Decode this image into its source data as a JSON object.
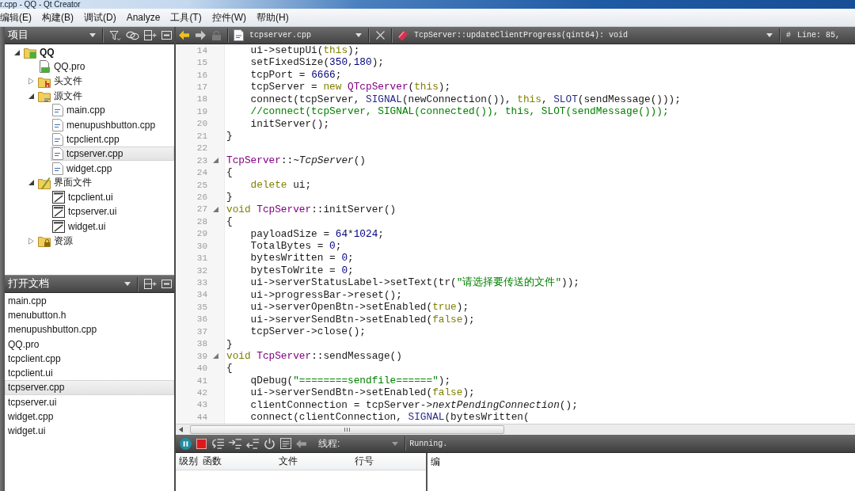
{
  "window": {
    "title": "r.cpp - QQ - Qt Creator"
  },
  "menu_bar": [
    "编辑(E)",
    "构建(B)",
    "调试(D)",
    "Analyze",
    "工具(T)",
    "控件(W)",
    "帮助(H)"
  ],
  "project_panel": {
    "title": "项目",
    "tree": [
      {
        "label": "QQ",
        "kind": "project",
        "expanded": true,
        "selected": false,
        "children": [
          {
            "label": "QQ.pro",
            "kind": "pro-file",
            "selected": false
          },
          {
            "label": "头文件",
            "kind": "headers",
            "expanded": false,
            "selected": false
          },
          {
            "label": "源文件",
            "kind": "sources",
            "expanded": true,
            "selected": false,
            "children": [
              {
                "label": "main.cpp",
                "kind": "cpp-file",
                "selected": false
              },
              {
                "label": "menupushbutton.cpp",
                "kind": "cpp-file",
                "selected": false
              },
              {
                "label": "tcpclient.cpp",
                "kind": "cpp-file",
                "selected": false
              },
              {
                "label": "tcpserver.cpp",
                "kind": "cpp-file",
                "selected": true
              },
              {
                "label": "widget.cpp",
                "kind": "cpp-file",
                "selected": false
              }
            ]
          },
          {
            "label": "界面文件",
            "kind": "forms",
            "expanded": true,
            "selected": false,
            "children": [
              {
                "label": "tcpclient.ui",
                "kind": "ui-file",
                "selected": false
              },
              {
                "label": "tcpserver.ui",
                "kind": "ui-file",
                "selected": false
              },
              {
                "label": "widget.ui",
                "kind": "ui-file",
                "selected": false
              }
            ]
          },
          {
            "label": "资源",
            "kind": "resources",
            "expanded": false,
            "selected": false
          }
        ]
      }
    ]
  },
  "open_documents": {
    "title": "打开文档",
    "items": [
      {
        "label": "main.cpp",
        "selected": false
      },
      {
        "label": "menubutton.h",
        "selected": false
      },
      {
        "label": "menupushbutton.cpp",
        "selected": false
      },
      {
        "label": "QQ.pro",
        "selected": false
      },
      {
        "label": "tcpclient.cpp",
        "selected": false
      },
      {
        "label": "tcpclient.ui",
        "selected": false
      },
      {
        "label": "tcpserver.cpp",
        "selected": true
      },
      {
        "label": "tcpserver.ui",
        "selected": false
      },
      {
        "label": "widget.cpp",
        "selected": false
      },
      {
        "label": "widget.ui",
        "selected": false
      }
    ]
  },
  "editor": {
    "document": "tcpserver.cpp",
    "symbol": "TcpServer::updateClientProgress(qint64): void",
    "line_marker": "#",
    "position": "Line: 85,",
    "lines": [
      {
        "number": "14",
        "foldable": false,
        "tokens": [
          {
            "kind": "plain",
            "text": "    ui->setupUi("
          },
          {
            "kind": "keyword",
            "text": "this"
          },
          {
            "kind": "plain",
            "text": ");"
          }
        ]
      },
      {
        "number": "15",
        "foldable": false,
        "tokens": [
          {
            "kind": "plain",
            "text": "    setFixedSize("
          },
          {
            "kind": "number",
            "text": "350"
          },
          {
            "kind": "plain",
            "text": ","
          },
          {
            "kind": "number",
            "text": "180"
          },
          {
            "kind": "plain",
            "text": ");"
          }
        ]
      },
      {
        "number": "16",
        "foldable": false,
        "tokens": [
          {
            "kind": "plain",
            "text": "    tcpPort = "
          },
          {
            "kind": "number",
            "text": "6666"
          },
          {
            "kind": "plain",
            "text": ";"
          }
        ]
      },
      {
        "number": "17",
        "foldable": false,
        "tokens": [
          {
            "kind": "plain",
            "text": "    tcpServer = "
          },
          {
            "kind": "keyword",
            "text": "new "
          },
          {
            "kind": "type",
            "text": "QTcpServer"
          },
          {
            "kind": "plain",
            "text": "("
          },
          {
            "kind": "keyword",
            "text": "this"
          },
          {
            "kind": "plain",
            "text": ");"
          }
        ]
      },
      {
        "number": "18",
        "foldable": false,
        "tokens": [
          {
            "kind": "plain",
            "text": "    connect(tcpServer, "
          },
          {
            "kind": "macro",
            "text": "SIGNAL"
          },
          {
            "kind": "plain",
            "text": "(newConnection()), "
          },
          {
            "kind": "keyword",
            "text": "this"
          },
          {
            "kind": "plain",
            "text": ", "
          },
          {
            "kind": "macro",
            "text": "SLOT"
          },
          {
            "kind": "plain",
            "text": "(sendMessage()));"
          }
        ]
      },
      {
        "number": "19",
        "foldable": false,
        "tokens": [
          {
            "kind": "comment",
            "text": "    //connect(tcpServer, SIGNAL(connected()), this, SLOT(sendMessage()));"
          }
        ]
      },
      {
        "number": "20",
        "foldable": false,
        "tokens": [
          {
            "kind": "plain",
            "text": "    initServer();"
          }
        ]
      },
      {
        "number": "21",
        "foldable": false,
        "tokens": [
          {
            "kind": "plain",
            "text": "}"
          }
        ]
      },
      {
        "number": "22",
        "foldable": false
      },
      {
        "number": "23",
        "foldable": true,
        "tokens": [
          {
            "kind": "type",
            "text": "TcpServer"
          },
          {
            "kind": "plain",
            "text": "::"
          },
          {
            "kind": "virtual",
            "text": "~TcpServer"
          },
          {
            "kind": "plain",
            "text": "()"
          }
        ]
      },
      {
        "number": "24",
        "foldable": false,
        "tokens": [
          {
            "kind": "plain",
            "text": "{"
          }
        ]
      },
      {
        "number": "25",
        "foldable": false,
        "tokens": [
          {
            "kind": "keyword",
            "text": "    delete"
          },
          {
            "kind": "plain",
            "text": " ui;"
          }
        ]
      },
      {
        "number": "26",
        "foldable": false,
        "tokens": [
          {
            "kind": "plain",
            "text": "}"
          }
        ]
      },
      {
        "number": "27",
        "foldable": true,
        "tokens": [
          {
            "kind": "keyword",
            "text": "void "
          },
          {
            "kind": "type",
            "text": "TcpServer"
          },
          {
            "kind": "plain",
            "text": "::initServer()"
          }
        ]
      },
      {
        "number": "28",
        "foldable": false,
        "tokens": [
          {
            "kind": "plain",
            "text": "{"
          }
        ]
      },
      {
        "number": "29",
        "foldable": false,
        "tokens": [
          {
            "kind": "plain",
            "text": "    payloadSize = "
          },
          {
            "kind": "number",
            "text": "64"
          },
          {
            "kind": "plain",
            "text": "*"
          },
          {
            "kind": "number",
            "text": "1024"
          },
          {
            "kind": "plain",
            "text": ";"
          }
        ]
      },
      {
        "number": "30",
        "foldable": false,
        "tokens": [
          {
            "kind": "plain",
            "text": "    TotalBytes = "
          },
          {
            "kind": "number",
            "text": "0"
          },
          {
            "kind": "plain",
            "text": ";"
          }
        ]
      },
      {
        "number": "31",
        "foldable": false,
        "tokens": [
          {
            "kind": "plain",
            "text": "    bytesWritten = "
          },
          {
            "kind": "number",
            "text": "0"
          },
          {
            "kind": "plain",
            "text": ";"
          }
        ]
      },
      {
        "number": "32",
        "foldable": false,
        "tokens": [
          {
            "kind": "plain",
            "text": "    bytesToWrite = "
          },
          {
            "kind": "number",
            "text": "0"
          },
          {
            "kind": "plain",
            "text": ";"
          }
        ]
      },
      {
        "number": "33",
        "foldable": false,
        "tokens": [
          {
            "kind": "plain",
            "text": "    ui->serverStatusLabel->setText(tr("
          },
          {
            "kind": "string",
            "text": "\"请选择要传送的文件\""
          },
          {
            "kind": "plain",
            "text": "));"
          }
        ]
      },
      {
        "number": "34",
        "foldable": false,
        "tokens": [
          {
            "kind": "plain",
            "text": "    ui->progressBar->reset();"
          }
        ]
      },
      {
        "number": "35",
        "foldable": false,
        "tokens": [
          {
            "kind": "plain",
            "text": "    ui->serverOpenBtn->setEnabled("
          },
          {
            "kind": "keyword",
            "text": "true"
          },
          {
            "kind": "plain",
            "text": ");"
          }
        ]
      },
      {
        "number": "36",
        "foldable": false,
        "tokens": [
          {
            "kind": "plain",
            "text": "    ui->serverSendBtn->setEnabled("
          },
          {
            "kind": "keyword",
            "text": "false"
          },
          {
            "kind": "plain",
            "text": ");"
          }
        ]
      },
      {
        "number": "37",
        "foldable": false,
        "tokens": [
          {
            "kind": "plain",
            "text": "    tcpServer->close();"
          }
        ]
      },
      {
        "number": "38",
        "foldable": false,
        "tokens": [
          {
            "kind": "plain",
            "text": "}"
          }
        ]
      },
      {
        "number": "39",
        "foldable": true,
        "tokens": [
          {
            "kind": "keyword",
            "text": "void "
          },
          {
            "kind": "type",
            "text": "TcpServer"
          },
          {
            "kind": "plain",
            "text": "::sendMessage()"
          }
        ]
      },
      {
        "number": "40",
        "foldable": false,
        "tokens": [
          {
            "kind": "plain",
            "text": "{"
          }
        ]
      },
      {
        "number": "41",
        "foldable": false,
        "tokens": [
          {
            "kind": "plain",
            "text": "    qDebug("
          },
          {
            "kind": "string",
            "text": "\"========sendfile======\""
          },
          {
            "kind": "plain",
            "text": ");"
          }
        ]
      },
      {
        "number": "42",
        "foldable": false,
        "tokens": [
          {
            "kind": "plain",
            "text": "    ui->serverSendBtn->setEnabled("
          },
          {
            "kind": "keyword",
            "text": "false"
          },
          {
            "kind": "plain",
            "text": ");"
          }
        ]
      },
      {
        "number": "43",
        "foldable": false,
        "tokens": [
          {
            "kind": "plain",
            "text": "    clientConnection = tcpServer->"
          },
          {
            "kind": "virtual",
            "text": "nextPendingConnection"
          },
          {
            "kind": "plain",
            "text": "();"
          }
        ]
      },
      {
        "number": "44",
        "foldable": false,
        "tokens": [
          {
            "kind": "plain",
            "text": "    connect(clientConnection, "
          },
          {
            "kind": "macro",
            "text": "SIGNAL"
          },
          {
            "kind": "plain",
            "text": "(bytesWritten("
          }
        ]
      }
    ]
  },
  "debugger": {
    "thread_label": "线程:",
    "status": "Running.",
    "stack_columns": [
      "级别",
      "函数",
      "文件",
      "行号"
    ],
    "side_panel_header": "编"
  }
}
